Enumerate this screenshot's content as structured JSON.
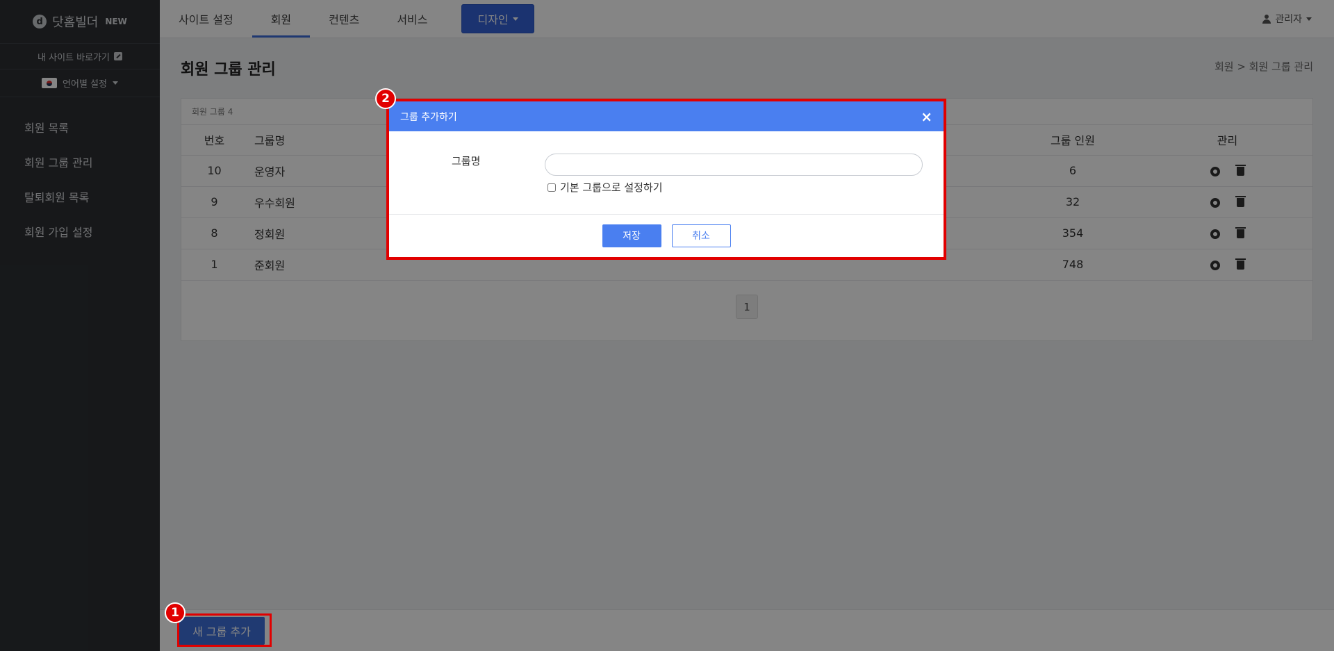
{
  "brand": {
    "logo_letter": "d",
    "name": "닷홈빌더",
    "badge": "NEW"
  },
  "sidebar": {
    "my_site_link": "내 사이트 바로가기",
    "language": "언어별 설정",
    "items": [
      {
        "label": "회원 목록"
      },
      {
        "label": "회원 그룹 관리"
      },
      {
        "label": "탈퇴회원 목록"
      },
      {
        "label": "회원 가입 설정"
      }
    ]
  },
  "topnav": {
    "tabs": [
      {
        "label": "사이트 설정"
      },
      {
        "label": "회원"
      },
      {
        "label": "컨텐츠"
      },
      {
        "label": "서비스"
      }
    ],
    "active_tab": "회원",
    "design_button": "디자인",
    "admin_label": "관리자"
  },
  "page": {
    "title": "회원 그룹 관리",
    "breadcrumb": "회원 > 회원 그룹 관리"
  },
  "group_table": {
    "caption": "회원 그룹 4",
    "columns": {
      "number": "번호",
      "name": "그룹명",
      "count": "그룹 인원",
      "manage": "관리"
    },
    "rows": [
      {
        "number": "10",
        "name": "운영자",
        "count": "6"
      },
      {
        "number": "9",
        "name": "우수회원",
        "count": "32"
      },
      {
        "number": "8",
        "name": "정회원",
        "count": "354"
      },
      {
        "number": "1",
        "name": "준회원",
        "count": "748"
      }
    ],
    "current_page": "1"
  },
  "bottombar": {
    "add_button": "새 그룹 추가"
  },
  "modal": {
    "title": "그룹 추가하기",
    "close": "×",
    "field_label": "그룹명",
    "field_value": "",
    "checkbox_label": "기본 그룹으로 설정하기",
    "save": "저장",
    "cancel": "취소"
  },
  "annotations": {
    "marker_1": "1",
    "marker_2": "2"
  },
  "colors": {
    "primary": "#4a7ff0",
    "highlight": "#e10000",
    "sidebar_bg": "#2c2f33"
  }
}
